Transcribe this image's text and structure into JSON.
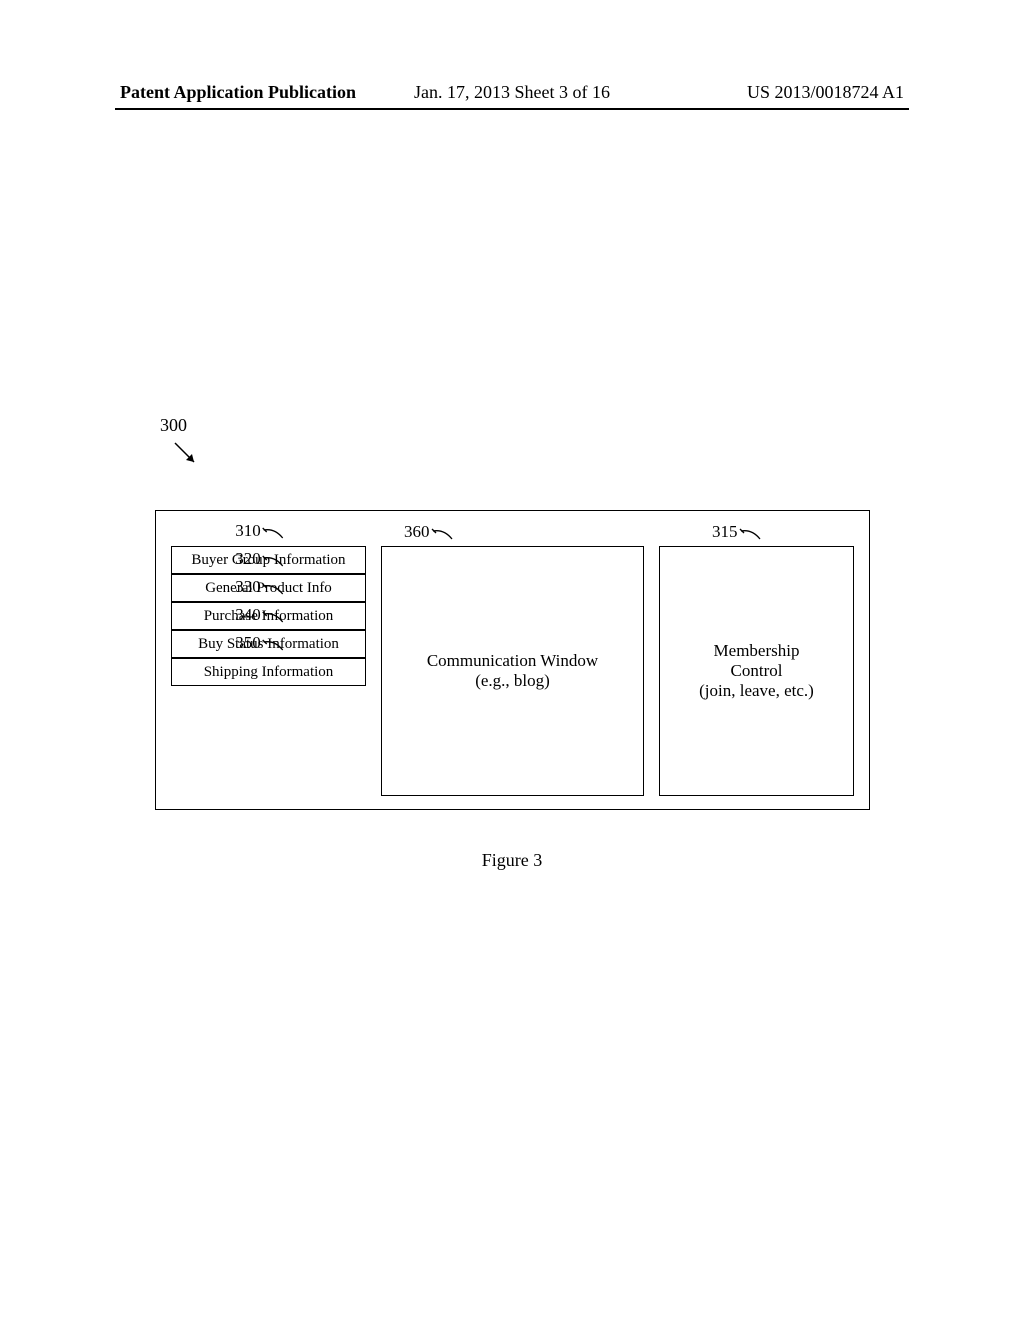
{
  "header": {
    "left": "Patent Application Publication",
    "center": "Jan. 17, 2013  Sheet 3 of 16",
    "right": "US 2013/0018724 A1"
  },
  "ref_300": "300",
  "refs": {
    "r310": "310",
    "r320": "320",
    "r330": "330",
    "r340": "340",
    "r350": "350",
    "r360": "360",
    "r315": "315"
  },
  "boxes": {
    "b310": "Buyer Group Information",
    "b320": "General Product Info",
    "b330": "Purchase Information",
    "b340": "Buy Status Information",
    "b350": "Shipping Information",
    "b360_line1": "Communication Window",
    "b360_line2": "(e.g., blog)",
    "b315_line1": "Membership",
    "b315_line2": "Control",
    "b315_line3": "(join, leave, etc.)"
  },
  "figure_caption": "Figure 3"
}
